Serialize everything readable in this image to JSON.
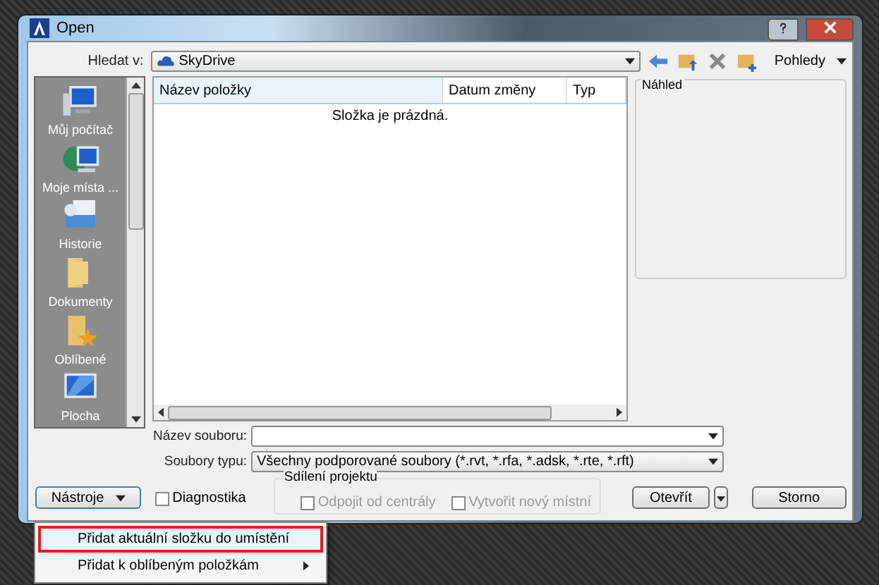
{
  "window": {
    "title": "Open"
  },
  "look_in": {
    "label": "Hledat v:",
    "value": "SkyDrive"
  },
  "toolbar": {
    "views_label": "Pohledy"
  },
  "places": [
    {
      "label": "Můj počítač"
    },
    {
      "label": "Moje místa ..."
    },
    {
      "label": "Historie"
    },
    {
      "label": "Dokumenty"
    },
    {
      "label": "Oblíbené"
    },
    {
      "label": "Plocha"
    }
  ],
  "file_list": {
    "columns": [
      "Název položky",
      "Datum změny",
      "Typ"
    ],
    "empty_message": "Složka je prázdná."
  },
  "preview": {
    "label": "Náhled"
  },
  "file_name": {
    "label": "Název souboru:"
  },
  "file_type": {
    "label": "Soubory typu:",
    "value": "Všechny podporované soubory  (*.rvt, *.rfa, *.adsk, *.rte, *.rft)"
  },
  "worksharing": {
    "title": "Sdílení projektu",
    "options": [
      {
        "label": "Odpojit od centrály",
        "checked": false,
        "disabled": true
      },
      {
        "label": "Vytvořit nový místní",
        "checked": false,
        "disabled": true
      }
    ]
  },
  "tools_button": "Nástroje",
  "diagnostics": {
    "label": "Diagnostika",
    "checked": false
  },
  "buttons": {
    "open": "Otevřít",
    "cancel": "Storno"
  },
  "tools_menu": [
    {
      "label": "Přidat aktuální složku do umístění",
      "selected": true,
      "submenu": false
    },
    {
      "label": "Přidat k oblíbeným položkám",
      "selected": false,
      "submenu": true
    }
  ]
}
